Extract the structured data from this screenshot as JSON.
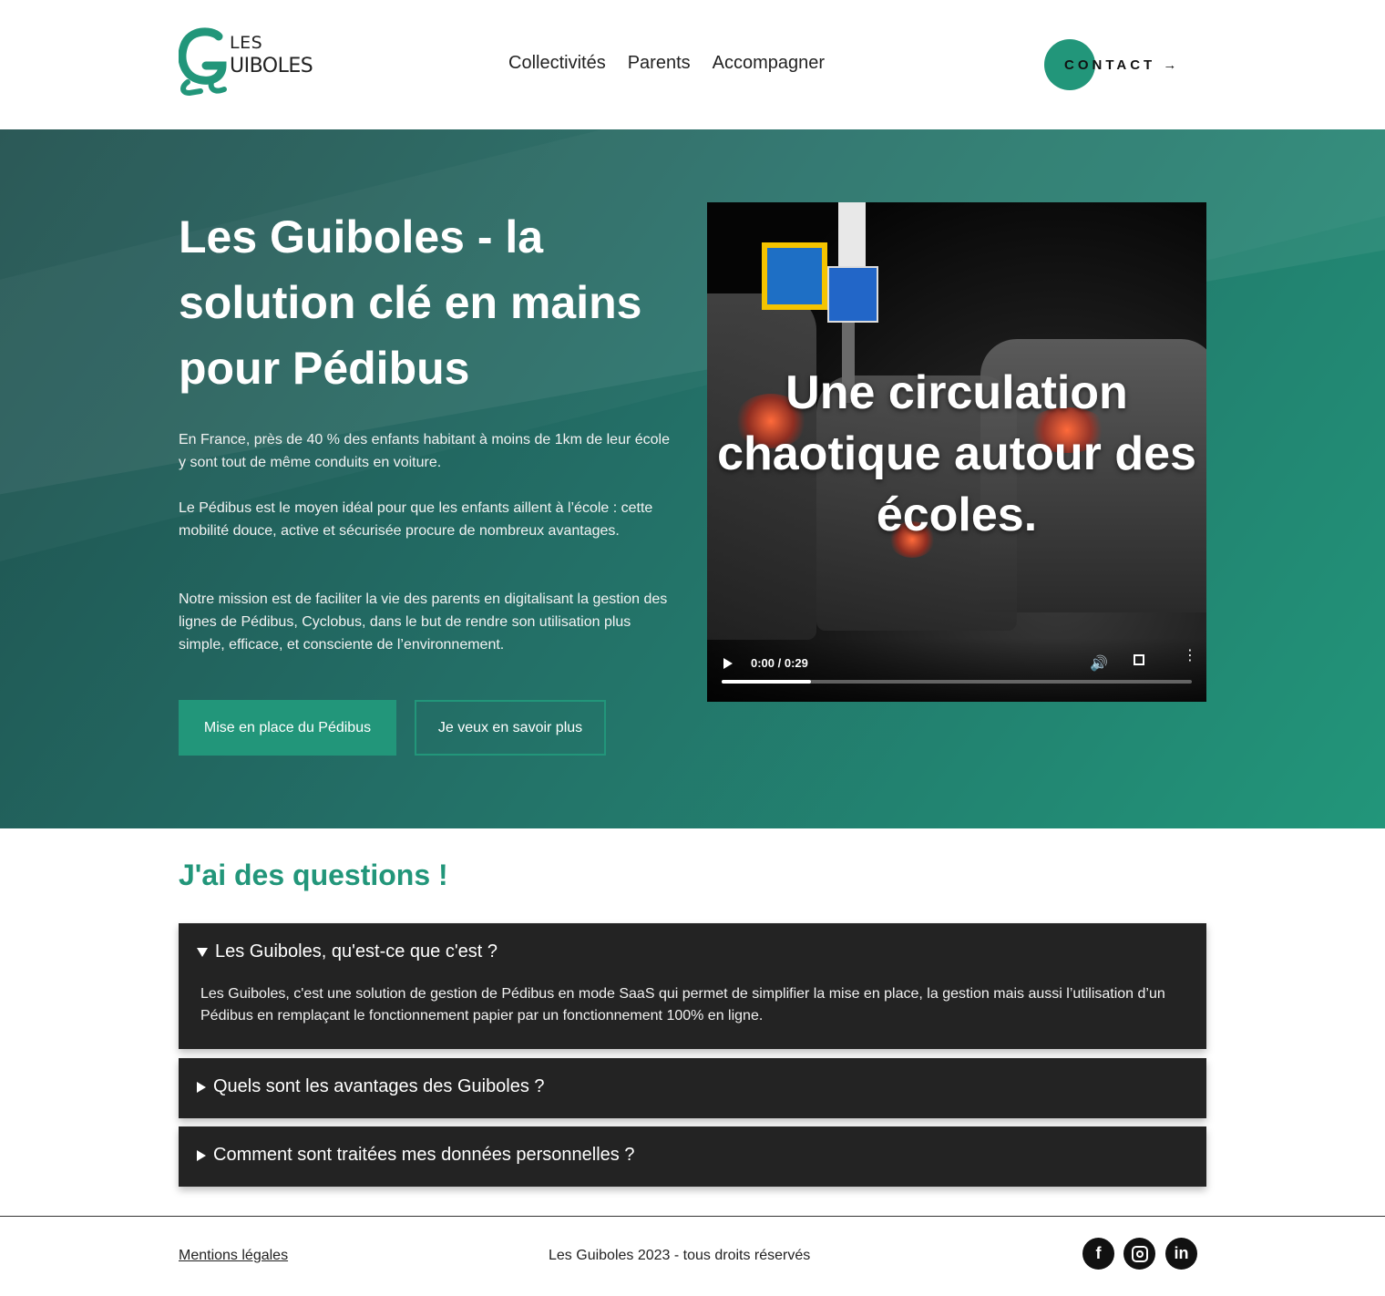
{
  "brand": {
    "logo_word1": "LES",
    "logo_word2": "UIBOLES",
    "accent_color": "#22967a",
    "dark_panel_color": "#232323"
  },
  "nav": {
    "items": [
      "Collectivités",
      "Parents",
      "Accompagner"
    ],
    "contact_label": "CONTACT →"
  },
  "hero": {
    "title": "Les Guiboles - la solution clé en mains pour Pédibus",
    "paragraph1": "En France, près de 40 % des enfants habitant à moins de 1km de leur école y sont tout de même conduits en voiture.",
    "paragraph2": "Le Pédibus est le moyen idéal pour que les enfants aillent à l’école : cette mobilité douce, active et sécurisée procure de nombreux avantages.",
    "paragraph3": "Notre mission est de faciliter la vie des parents en digitalisant la gestion des lignes de Pédibus, Cyclobus, dans le but de rendre son utilisation plus simple, efficace, et consciente de l’environnement.",
    "primary_button": "Mise en place du Pédibus",
    "secondary_button": "Je veux en savoir plus"
  },
  "video": {
    "overlay_text": "Une circulation chaotique autour des écoles.",
    "time": "0:00 / 0:29",
    "progress_fraction": 0.19,
    "icons": [
      "play-icon",
      "volume-icon",
      "fullscreen-icon",
      "more-options-icon"
    ]
  },
  "faq": {
    "title": "J'ai des questions !",
    "items": [
      {
        "question": "Les Guiboles, qu'est-ce que c'est ?",
        "answer": "Les Guiboles, c'est une solution de gestion de Pédibus en mode SaaS qui permet de simplifier la mise en place, la gestion mais aussi l’utilisation d’un Pédibus en remplaçant le fonctionnement papier par un fonctionnement 100% en ligne.",
        "open": true
      },
      {
        "question": "Quels sont les avantages des Guiboles ?",
        "open": false
      },
      {
        "question": "Comment sont traitées mes données personnelles ?",
        "open": false
      }
    ]
  },
  "footer": {
    "legal_link": "Mentions légales",
    "copyright": "Les Guiboles 2023 - tous droits réservés",
    "social": [
      {
        "icon": "facebook-icon",
        "glyph": "f"
      },
      {
        "icon": "instagram-icon"
      },
      {
        "icon": "linkedin-icon",
        "glyph": "in"
      }
    ]
  }
}
